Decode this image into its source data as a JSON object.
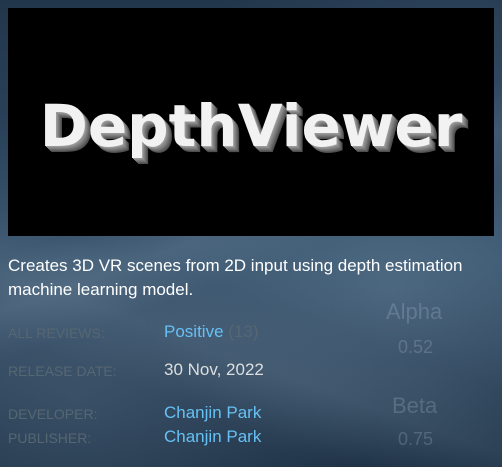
{
  "capsule": {
    "title": "DepthViewer"
  },
  "description": "Creates 3D VR scenes from 2D input using depth estimation machine learning model.",
  "background_text": {
    "alpha_label": "Alpha",
    "alpha_value": "0.52",
    "beta_label": "Beta",
    "beta_value": "0.75"
  },
  "info": {
    "reviews_label": "ALL REVIEWS:",
    "reviews_summary": "Positive",
    "reviews_count": "(13)",
    "release_label": "RELEASE DATE:",
    "release_date": "30 Nov, 2022",
    "developer_label": "DEVELOPER:",
    "developer": "Chanjin Park",
    "publisher_label": "PUBLISHER:",
    "publisher": "Chanjin Park"
  },
  "colors": {
    "link": "#66c0f4",
    "label": "#556772",
    "text": "#dcdedf"
  }
}
